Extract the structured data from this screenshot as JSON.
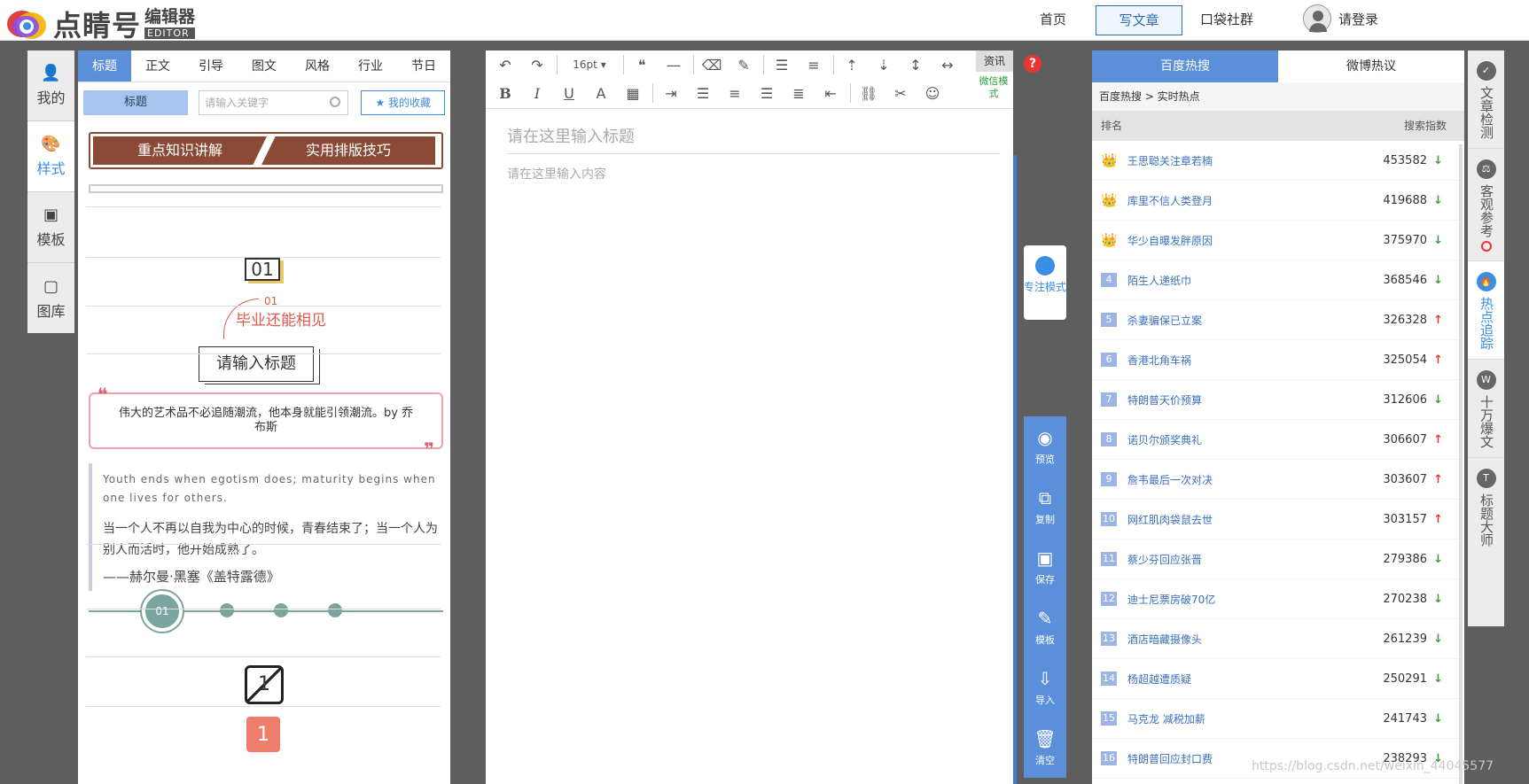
{
  "brand": {
    "name": "点睛号",
    "sub_cn": "编辑器",
    "sub_en": "EDITOR"
  },
  "topnav": {
    "home": "首页",
    "write": "写文章",
    "pocket": "口袋社群",
    "login": "请登录"
  },
  "left_nav": [
    {
      "label": "我的",
      "icon": "person-icon"
    },
    {
      "label": "样式",
      "icon": "palette-icon"
    },
    {
      "label": "模板",
      "icon": "template-icon"
    },
    {
      "label": "图库",
      "icon": "image-icon"
    }
  ],
  "style_panel": {
    "tabs": [
      "标题",
      "正文",
      "引导",
      "图文",
      "风格",
      "行业",
      "节日"
    ],
    "category": "标题",
    "search_placeholder": "请输入关键字",
    "favorites": "我的收藏",
    "title_a": "重点知识讲解",
    "title_b": "实用排版技巧",
    "badge_01": "01",
    "grad_num": "01",
    "grad_text": "毕业还能相见",
    "placeholder_title": "请输入标题",
    "quote": "伟大的艺术品不必追随潮流，他本身就能引领潮流。by 乔布斯",
    "essay_en": "Youth ends when egotism does; maturity begins when one lives for others.",
    "essay_cn": "当一个人不再以自我为中心的时候，青春结束了；当一个人为别人而活时，他开始成熟了。",
    "essay_author": "——赫尔曼·黑塞《盖特露德》",
    "timeline_num": "01",
    "slash_num": "1",
    "gift_num": "1"
  },
  "editor": {
    "font_size": "16pt",
    "news": "资讯",
    "wechat_mode": "微信模式",
    "title_placeholder": "请在这里输入标题",
    "body_placeholder": "请在这里输入内容",
    "help": "?"
  },
  "tools": {
    "focus": "专注模式",
    "items": [
      "预览",
      "复制",
      "保存",
      "模板",
      "导入",
      "清空"
    ]
  },
  "hot_panel": {
    "tabs": [
      "百度热搜",
      "微博热议"
    ],
    "crumb": "百度热搜 > 实时热点",
    "col_rank": "排名",
    "col_index": "搜索指数",
    "items": [
      {
        "rank": "1",
        "title": "王思聪关注章若楠",
        "index": "453582",
        "trend": "↓"
      },
      {
        "rank": "2",
        "title": "库里不信人类登月",
        "index": "419688",
        "trend": "↓"
      },
      {
        "rank": "3",
        "title": "华少自曝发胖原因",
        "index": "375970",
        "trend": "↓"
      },
      {
        "rank": "4",
        "title": "陌生人递纸巾",
        "index": "368546",
        "trend": "↓"
      },
      {
        "rank": "5",
        "title": "杀妻骗保已立案",
        "index": "326328",
        "trend": "↑"
      },
      {
        "rank": "6",
        "title": "香港北角车祸",
        "index": "325054",
        "trend": "↑"
      },
      {
        "rank": "7",
        "title": "特朗普天价预算",
        "index": "312606",
        "trend": "↓"
      },
      {
        "rank": "8",
        "title": "诺贝尔颁奖典礼",
        "index": "306607",
        "trend": "↑"
      },
      {
        "rank": "9",
        "title": "詹韦最后一次对决",
        "index": "303607",
        "trend": "↑"
      },
      {
        "rank": "10",
        "title": "网红肌肉袋鼠去世",
        "index": "303157",
        "trend": "↑"
      },
      {
        "rank": "11",
        "title": "蔡少芬回应张晋",
        "index": "279386",
        "trend": "↓"
      },
      {
        "rank": "12",
        "title": "迪士尼票房破70亿",
        "index": "270238",
        "trend": "↓"
      },
      {
        "rank": "13",
        "title": "酒店暗藏摄像头",
        "index": "261239",
        "trend": "↓"
      },
      {
        "rank": "14",
        "title": "杨超越遭质疑",
        "index": "250291",
        "trend": "↓"
      },
      {
        "rank": "15",
        "title": "马克龙 减税加薪",
        "index": "241743",
        "trend": "↓"
      },
      {
        "rank": "16",
        "title": "特朗普回应封口费",
        "index": "238293",
        "trend": "↓"
      }
    ]
  },
  "right_nav": [
    {
      "label": "文章检测",
      "icon": "shield-icon"
    },
    {
      "label": "客观参考",
      "icon": "scale-icon"
    },
    {
      "label": "热点追踪",
      "icon": "hot-icon"
    },
    {
      "label": "十万爆文",
      "icon": "w-icon"
    },
    {
      "label": "标题大师",
      "icon": "title-icon"
    }
  ],
  "watermark": "https://blog.csdn.net/weixin_44045577",
  "colors": {
    "accent": "#5b8fd9",
    "brown": "#8b4a36",
    "teal": "#7aa59f",
    "up": "#e33333",
    "down": "#3a9c3a"
  }
}
